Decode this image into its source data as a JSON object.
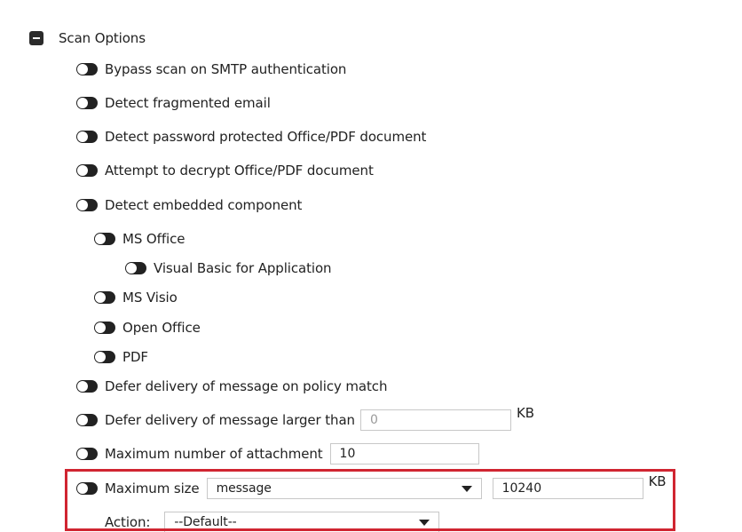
{
  "section": {
    "title": "Scan Options"
  },
  "options": {
    "bypass_scan": "Bypass scan on SMTP authentication",
    "detect_fragmented": "Detect fragmented email",
    "detect_password": "Detect password protected Office/PDF document",
    "attempt_decrypt": "Attempt to decrypt Office/PDF document",
    "detect_embedded": "Detect embedded component",
    "ms_office": "MS Office",
    "vba": "Visual Basic for Application",
    "ms_visio": "MS Visio",
    "open_office": "Open Office",
    "pdf": "PDF",
    "defer_policy": "Defer delivery of message on policy match",
    "defer_larger": "Defer delivery of message larger than",
    "defer_larger_value": "0",
    "defer_larger_unit": "KB",
    "max_attachment": "Maximum number of attachment",
    "max_attachment_value": "10",
    "max_size": "Maximum size",
    "max_size_select": "message",
    "max_size_value": "10240",
    "max_size_unit": "KB",
    "action_label": "Action:",
    "action_select": "--Default--"
  },
  "colors": {
    "highlight": "#d02531",
    "toggle": "#222222"
  },
  "icons": {
    "collapse": "minus-square-icon",
    "toggle": "toggle-off-icon",
    "dropdown": "caret-down-icon"
  }
}
